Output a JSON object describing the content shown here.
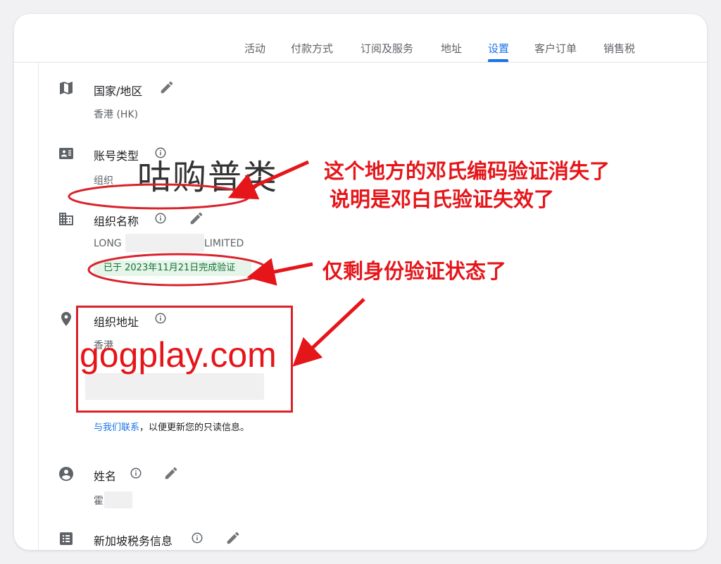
{
  "tabs": [
    {
      "label": "活动"
    },
    {
      "label": "付款方式"
    },
    {
      "label": "订阅及服务"
    },
    {
      "label": "地址"
    },
    {
      "label": "设置",
      "active": true
    },
    {
      "label": "客户订单"
    },
    {
      "label": "销售税"
    }
  ],
  "sections": {
    "country": {
      "label": "国家/地区",
      "value": "香港 (HK)"
    },
    "account_type": {
      "label": "账号类型",
      "value": "组织"
    },
    "org_name": {
      "label": "组织名称",
      "value_prefix": "LONG",
      "value_suffix": "LIMITED",
      "verified": "已于 2023年11月21日完成验证"
    },
    "org_address": {
      "label": "组织地址",
      "value": "香港"
    },
    "contact": {
      "link": "与我们联系",
      "text": "，以便更新您的只读信息。"
    },
    "name": {
      "label": "姓名",
      "value": "霍"
    },
    "sg_tax": {
      "label": "新加坡税务信息"
    }
  },
  "annotations": {
    "watermark": "咕购普类",
    "line1": "这个地方的邓氏编码验证消失了",
    "line2": "说明是邓白氏验证失效了",
    "line3": "仅剩身份验证状态了",
    "brand": "gogplay.com"
  },
  "colors": {
    "accent": "#1a73e8",
    "annotation": "#e5161a",
    "verified_bg": "#e6f4ea",
    "verified_text": "#137333"
  },
  "icons": [
    "map-icon",
    "id-card-icon",
    "building-icon",
    "location-pin-icon",
    "account-circle-icon",
    "list-icon",
    "info-icon",
    "pencil-icon"
  ]
}
